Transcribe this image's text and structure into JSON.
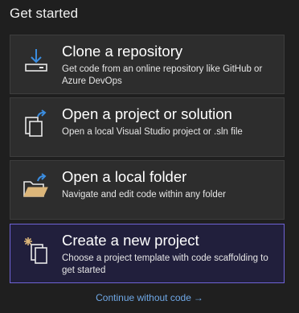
{
  "heading": "Get started",
  "cards": [
    {
      "title": "Clone a repository",
      "description": "Get code from an online repository like GitHub or Azure DevOps",
      "icon": "clone-download-icon"
    },
    {
      "title": "Open a project or solution",
      "description": "Open a local Visual Studio project or .sln file",
      "icon": "open-project-icon"
    },
    {
      "title": "Open a local folder",
      "description": "Navigate and edit code within any folder",
      "icon": "folder-icon"
    },
    {
      "title": "Create a new project",
      "description": "Choose a project template with code scaffolding to get started",
      "icon": "new-project-icon",
      "selected": true
    }
  ],
  "continue_link": {
    "label": "Continue without code",
    "arrow": "→"
  },
  "colors": {
    "background": "#1f1f1f",
    "card": "#2d2d2d",
    "selected_card": "#211f3c",
    "selected_border": "#6f63d6",
    "link": "#6fa8e6",
    "icon_blue": "#3b8de0",
    "folder_yellow": "#dcb67a"
  }
}
